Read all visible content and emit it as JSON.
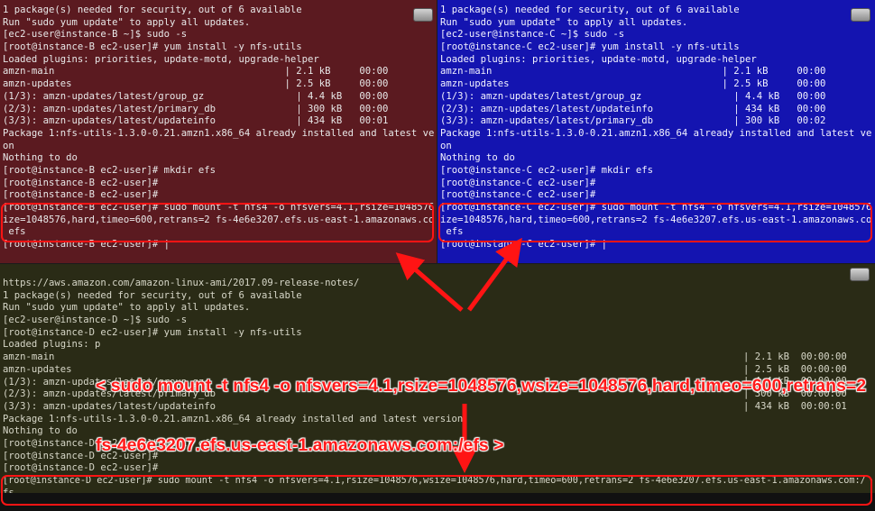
{
  "pane_b": {
    "lines": [
      "1 package(s) needed for security, out of 6 available",
      "Run \"sudo yum update\" to apply all updates.",
      "[ec2-user@instance-B ~]$ sudo -s",
      "[root@instance-B ec2-user]# yum install -y nfs-utils",
      "Loaded plugins: priorities, update-motd, upgrade-helper",
      "amzn-main                                        | 2.1 kB     00:00",
      "amzn-updates                                     | 2.5 kB     00:00",
      "(1/3): amzn-updates/latest/group_gz                | 4.4 kB   00:00",
      "(2/3): amzn-updates/latest/primary_db              | 300 kB   00:00",
      "(3/3): amzn-updates/latest/updateinfo              | 434 kB   00:01",
      "Package 1:nfs-utils-1.3.0-0.21.amzn1.x86_64 already installed and latest versi",
      "on",
      "Nothing to do",
      "[root@instance-B ec2-user]# mkdir efs",
      "[root@instance-B ec2-user]#",
      "[root@instance-B ec2-user]#",
      "[root@instance-B ec2-user]# sudo mount -t nfs4 -o nfsvers=4.1,rsize=1048576,ws",
      "ize=1048576,hard,timeo=600,retrans=2 fs-4e6e3207.efs.us-east-1.amazonaws.com:/",
      " efs",
      "[root@instance-B ec2-user]# |"
    ]
  },
  "pane_c": {
    "lines": [
      "1 package(s) needed for security, out of 6 available",
      "Run \"sudo yum update\" to apply all updates.",
      "[ec2-user@instance-C ~]$ sudo -s",
      "[root@instance-C ec2-user]# yum install -y nfs-utils",
      "Loaded plugins: priorities, update-motd, upgrade-helper",
      "amzn-main                                        | 2.1 kB     00:00",
      "amzn-updates                                     | 2.5 kB     00:00",
      "(1/3): amzn-updates/latest/group_gz                | 4.4 kB   00:00",
      "(2/3): amzn-updates/latest/updateinfo              | 434 kB   00:00",
      "(3/3): amzn-updates/latest/primary_db              | 300 kB   00:02",
      "Package 1:nfs-utils-1.3.0-0.21.amzn1.x86_64 already installed and latest versi",
      "on",
      "Nothing to do",
      "[root@instance-C ec2-user]# mkdir efs",
      "[root@instance-C ec2-user]#",
      "[root@instance-C ec2-user]#",
      "[root@instance-C ec2-user]# sudo mount -t nfs4 -o nfsvers=4.1,rsize=1048576,ws",
      "ize=1048576,hard,timeo=600,retrans=2 fs-4e6e3207.efs.us-east-1.amazonaws.com:/",
      " efs",
      "[root@instance-C ec2-user]# |"
    ]
  },
  "pane_d": {
    "lines": [
      "https://aws.amazon.com/amazon-linux-ami/2017.09-release-notes/",
      "1 package(s) needed for security, out of 6 available",
      "Run \"sudo yum update\" to apply all updates.",
      "[ec2-user@instance-D ~]$ sudo -s",
      "[root@instance-D ec2-user]# yum install -y nfs-utils",
      "Loaded plugins: p",
      "amzn-main",
      "amzn-updates",
      "(1/3): amzn-updates/latest/group_gz",
      "(2/3): amzn-updates/latest/primary_db",
      "(3/3): amzn-updates/latest/updateinfo",
      "Package 1:nfs-utils-1.3.0-0.21.amzn1.x86_64 already installed and latest version",
      "Nothing to do",
      "[root@instance-D ec2-user]# mkdir efs",
      "[root@instance-D ec2-user]#",
      "[root@instance-D ec2-user]#",
      "[root@instance-D ec2-user]# sudo mount -t nfs4 -o nfsvers=4.1,rsize=1048576,wsize=1048576,hard,timeo=600,retrans=2 fs-4e6e3207.efs.us-east-1.amazonaws.com:/ e",
      "fs"
    ],
    "right_col": [
      "| 2.1 kB  00:00:00",
      "| 2.5 kB  00:00:00",
      "| 4.4 kB  00:00:00",
      "| 300 kB  00:00:00",
      "| 434 kB  00:00:01"
    ]
  },
  "annotation": {
    "line1": "< sudo mount -t nfs4 -o nfsvers=4.1,rsize=1048576,wsize=1048576,hard,timeo=600,retrans=2",
    "line2": "fs-4e6e3207.efs.us-east-1.amazonaws.com:/efs >"
  },
  "colors": {
    "pane_b_bg": "#5b1a20",
    "pane_c_bg": "#1414b0",
    "pane_d_bg": "#2a2b16",
    "highlight": "#ff1414"
  }
}
